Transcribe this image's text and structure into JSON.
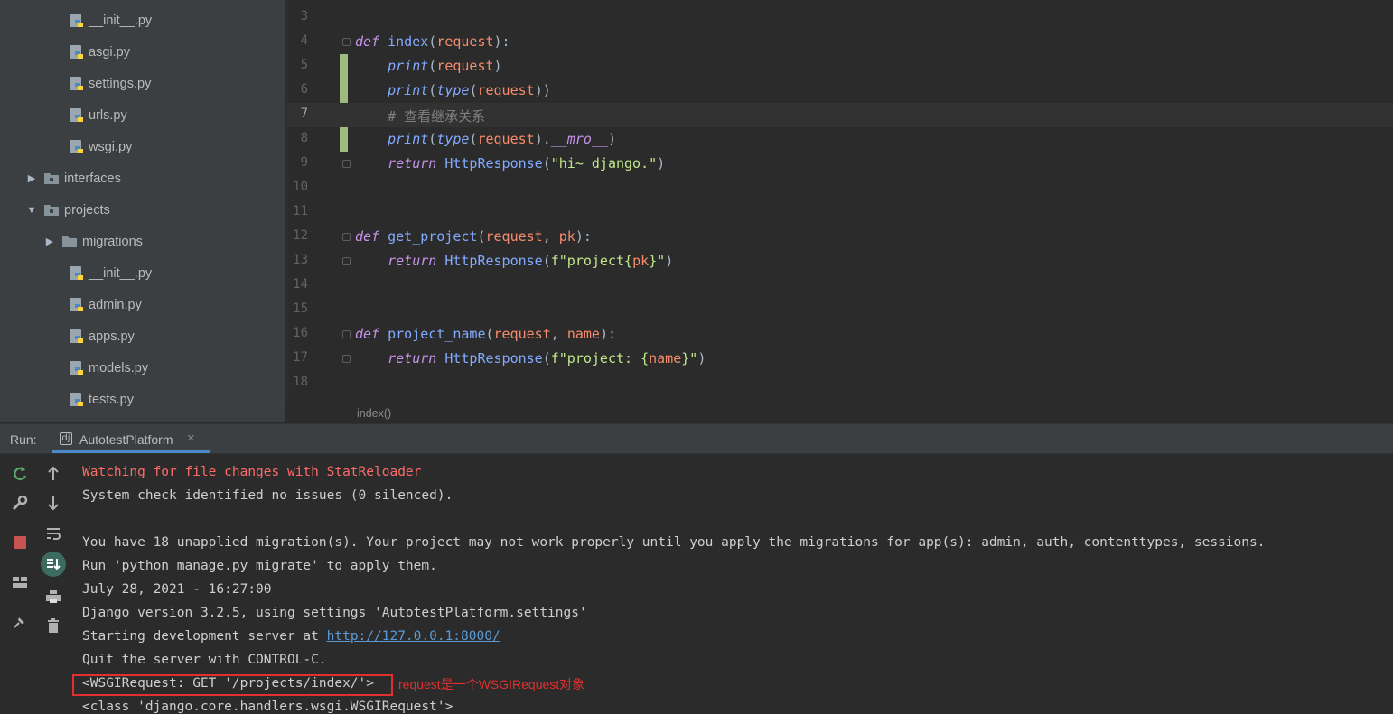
{
  "tree": {
    "items": [
      {
        "label": "__init__.py",
        "kind": "python-file"
      },
      {
        "label": "asgi.py",
        "kind": "python-file"
      },
      {
        "label": "settings.py",
        "kind": "python-file"
      },
      {
        "label": "urls.py",
        "kind": "python-file"
      },
      {
        "label": "wsgi.py",
        "kind": "python-file"
      },
      {
        "label": "interfaces",
        "kind": "folder",
        "expanded": false
      },
      {
        "label": "projects",
        "kind": "folder",
        "expanded": true
      },
      {
        "label": "migrations",
        "kind": "folder",
        "expanded": false
      },
      {
        "label": "__init__.py",
        "kind": "python-file"
      },
      {
        "label": "admin.py",
        "kind": "python-file"
      },
      {
        "label": "apps.py",
        "kind": "python-file"
      },
      {
        "label": "models.py",
        "kind": "python-file"
      },
      {
        "label": "tests.py",
        "kind": "python-file"
      }
    ]
  },
  "editor": {
    "current_line": 7,
    "lines": [
      {
        "num": "3"
      },
      {
        "num": "4"
      },
      {
        "num": "5"
      },
      {
        "num": "6"
      },
      {
        "num": "7"
      },
      {
        "num": "8"
      },
      {
        "num": "9"
      },
      {
        "num": "10"
      },
      {
        "num": "11"
      },
      {
        "num": "12"
      },
      {
        "num": "13"
      },
      {
        "num": "14"
      },
      {
        "num": "15"
      },
      {
        "num": "16"
      },
      {
        "num": "17"
      },
      {
        "num": "18"
      }
    ],
    "tokens": {
      "def": "def",
      "index": "index",
      "request": "request",
      "print": "print",
      "type": "type",
      "comment": "# 查看继承关系",
      "mro": "__mro__",
      "return": "return",
      "HttpResponse": "HttpResponse",
      "hi_str": "\"hi~ django.\"",
      "get_project": "get_project",
      "pk": "pk",
      "fstr1_a": "f\"project{",
      "fstr1_b": "}\"",
      "project_name": "project_name",
      "name": "name",
      "fstr2_a": "f\"project: {",
      "fstr2_b": "}\""
    },
    "breadcrumb": "index()"
  },
  "run": {
    "label": "Run:",
    "tab_title": "AutotestPlatform",
    "tab_icon": "dj",
    "close": "×",
    "console": [
      {
        "text": "Watching for file changes with StatReloader",
        "style": "red"
      },
      {
        "text": "System check identified no issues (0 silenced).",
        "style": "normal"
      },
      {
        "text": "",
        "style": "normal"
      },
      {
        "text": "You have 18 unapplied migration(s). Your project may not work properly until you apply the migrations for app(s): admin, auth, contenttypes, sessions.",
        "style": "normal"
      },
      {
        "text": "Run 'python manage.py migrate' to apply them.",
        "style": "normal"
      },
      {
        "text": "July 28, 2021 - 16:27:00",
        "style": "normal"
      },
      {
        "text": "Django version 3.2.5, using settings 'AutotestPlatform.settings'",
        "style": "normal"
      },
      {
        "text_prefix": "Starting development server at ",
        "link": "http://127.0.0.1:8000/",
        "style": "normal"
      },
      {
        "text": "Quit the server with CONTROL-C.",
        "style": "normal"
      },
      {
        "text": "<WSGIRequest: GET '/projects/index/'>",
        "style": "normal"
      },
      {
        "text": "<class 'django.core.handlers.wsgi.WSGIRequest'>",
        "style": "normal"
      }
    ],
    "annotation": "request是一个WSGIRequest对象"
  },
  "colors": {
    "accent": "#4a88c7",
    "annotation": "#e03030",
    "error_text": "#ff6b68",
    "change_marker": "#b4d48e"
  }
}
